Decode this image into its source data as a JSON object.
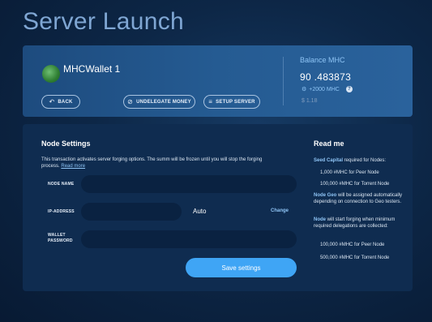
{
  "page": {
    "title": "Server Launch"
  },
  "wallet": {
    "name": "MHCWallet 1",
    "back_label": "BACK",
    "undelegate_label": "UNDELEGATE MONEY",
    "setup_label": "SETUP SERVER",
    "balance_label": "Balance MHC",
    "balance_value": "90 .483873",
    "bonus": "+2000 MHC",
    "help": "?",
    "usd": "$ 1.18"
  },
  "node_settings": {
    "title": "Node Settings",
    "description": "This transaction activates server forging options. The summ will be frozen until you will stop the forging process.",
    "read_more": "Read more",
    "fields": {
      "node_name_label": "NODE NAME",
      "ip_label": "IP-ADDRESS",
      "ip_mode": "Auto",
      "change_label": "Change",
      "password_label_1": "WALLET",
      "password_label_2": "PASSWORD"
    },
    "save_label": "Save settings"
  },
  "readme": {
    "title": "Read me",
    "seed_capital": "Seed Capital",
    "seed_suffix": " required for Nodes:",
    "seed_peer": "1,000 #MHC for Peer Node",
    "seed_torrent": "100,000 #MHC for Torrent Node",
    "node_geo": "Node Geo",
    "node_geo_suffix": " will be assigned automatically depending on connection to Geo testers.",
    "node": "Node",
    "node_suffix": " will start forging when minimum required delegations are collected:",
    "deleg_peer": "100,000 #MHC for Peer Node",
    "deleg_torrent": "500,000 #MHC for Torrent Node"
  },
  "icons": {
    "back": "back-arrow-icon",
    "undelegate": "undelegate-icon",
    "setup": "setup-server-icon",
    "bonus": "bonus-gear-icon",
    "help": "help-icon"
  },
  "colors": {
    "accent": "#3fa5f5",
    "link": "#8ec4f5",
    "title": "#7fa6d3"
  }
}
